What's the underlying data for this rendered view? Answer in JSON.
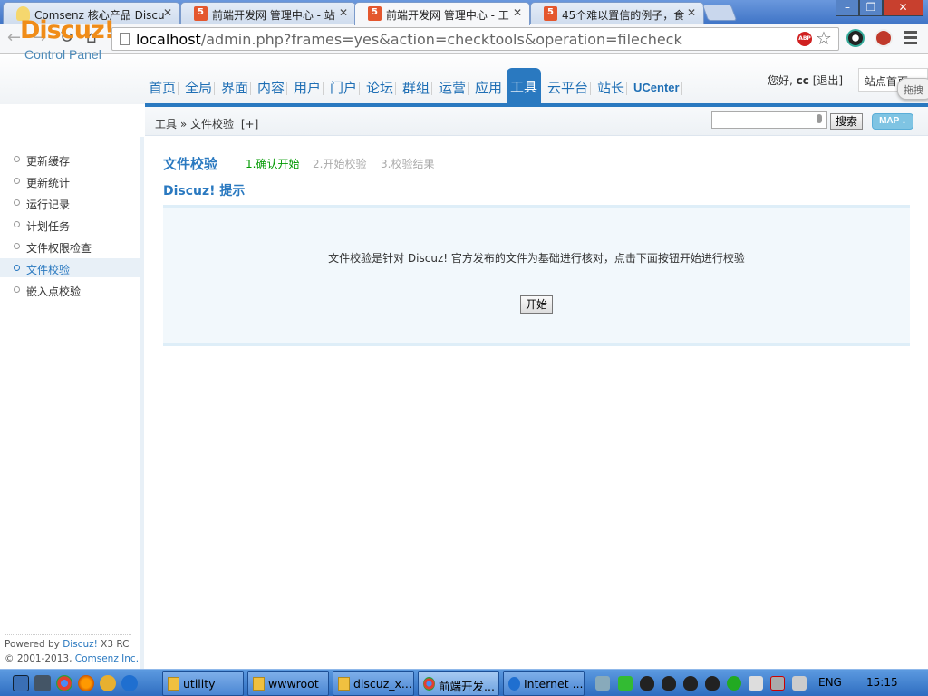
{
  "browser": {
    "tabs": [
      {
        "title": "Comsenz 核心产品 Discu",
        "icon": "comsenz-icon"
      },
      {
        "title": "前端开发网 管理中心 - 站",
        "icon": "html5-icon"
      },
      {
        "title": "前端开发网 管理中心 - 工",
        "icon": "html5-icon",
        "active": true
      },
      {
        "title": "45个难以置信的例子，食",
        "icon": "html5-icon"
      }
    ],
    "close_glyph": "✕",
    "window_controls": {
      "minimize": "–",
      "maximize": "❐",
      "close": "✕"
    },
    "url_host": "localhost",
    "url_rest": "/admin.php?frames=yes&action=checktools&operation=filecheck",
    "abp_label": "ABP"
  },
  "header": {
    "logo": "Discuz!",
    "logo_sub": "Control Panel",
    "nav": [
      "首页",
      "全局",
      "界面",
      "内容",
      "用户",
      "门户",
      "论坛",
      "群组",
      "运营",
      "应用",
      "工具",
      "云平台",
      "站长",
      "UCenter"
    ],
    "active_nav": "工具",
    "greeting": "您好,",
    "username": "cc",
    "logout": "[退出]",
    "site_home": "站点首页",
    "drag_label": "拖拽"
  },
  "breadcrumb": {
    "root": "工具",
    "separator": "»",
    "current": "文件校验",
    "add": "[+]",
    "search_button": "搜索",
    "map_button": "MAP ↓"
  },
  "sidebar": {
    "items": [
      "更新缓存",
      "更新统计",
      "运行记录",
      "计划任务",
      "文件权限检查",
      "文件校验",
      "嵌入点校验"
    ],
    "active": "文件校验",
    "powered_prefix": "Powered by ",
    "powered_brand": "Discuz!",
    "powered_version": " X3 RC",
    "copyright_prefix": "© 2001-2013, ",
    "copyright_company": "Comsenz Inc."
  },
  "main": {
    "title": "文件校验",
    "steps": [
      "1.确认开始",
      "2.开始校验",
      "3.校验结果"
    ],
    "tip_title": "Discuz! 提示",
    "tip_text": "文件校验是针对 Discuz! 官方发布的文件为基础进行核对，点击下面按钮开始进行校验",
    "start_button": "开始"
  },
  "taskbar": {
    "tasks": [
      {
        "label": "utility",
        "icon": "folder"
      },
      {
        "label": "wwwroot",
        "icon": "folder"
      },
      {
        "label": "discuz_x...",
        "icon": "folder"
      },
      {
        "label": "前端开发...",
        "icon": "chrome"
      },
      {
        "label": "Internet ...",
        "icon": "ie"
      }
    ],
    "language": "ENG",
    "time": "15:15"
  }
}
